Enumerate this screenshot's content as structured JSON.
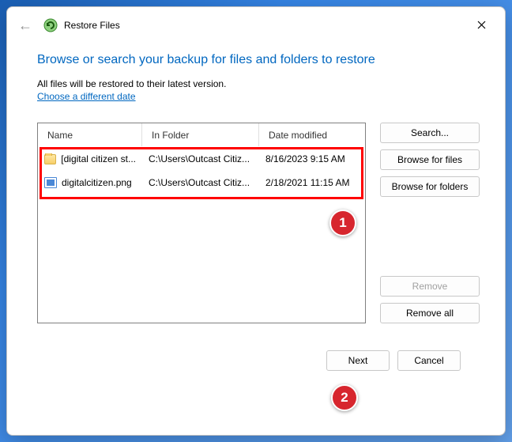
{
  "titlebar": {
    "app_title": "Restore Files"
  },
  "header": {
    "page_title": "Browse or search your backup for files and folders to restore",
    "subtext": "All files will be restored to their latest version.",
    "link": "Choose a different date"
  },
  "columns": {
    "name": "Name",
    "folder": "In Folder",
    "date": "Date modified"
  },
  "rows": [
    {
      "icon": "folder",
      "name": "[digital citizen st...",
      "folder": "C:\\Users\\Outcast Citiz...",
      "date": "8/16/2023 9:15 AM"
    },
    {
      "icon": "image",
      "name": "digitalcitizen.png",
      "folder": "C:\\Users\\Outcast Citiz...",
      "date": "2/18/2021 11:15 AM"
    }
  ],
  "buttons": {
    "search": "Search...",
    "browse_files": "Browse for files",
    "browse_folders": "Browse for folders",
    "remove": "Remove",
    "remove_all": "Remove all",
    "next": "Next",
    "cancel": "Cancel"
  },
  "annotations": {
    "callout1": "1",
    "callout2": "2"
  }
}
